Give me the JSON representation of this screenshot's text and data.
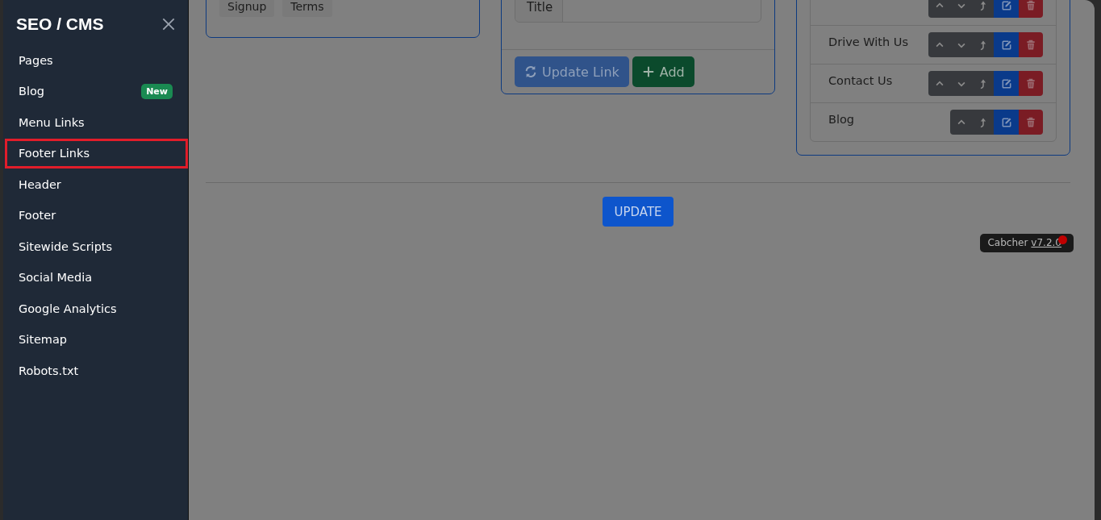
{
  "sidebar": {
    "title": "SEO / CMS",
    "items": [
      {
        "label": "Pages",
        "selected": false
      },
      {
        "label": "Blog",
        "selected": false,
        "badge": "New"
      },
      {
        "label": "Menu Links",
        "selected": false
      },
      {
        "label": "Footer Links",
        "selected": true
      },
      {
        "label": "Header",
        "selected": false
      },
      {
        "label": "Footer",
        "selected": false
      },
      {
        "label": "Sitewide Scripts",
        "selected": false
      },
      {
        "label": "Social Media",
        "selected": false
      },
      {
        "label": "Google Analytics",
        "selected": false
      },
      {
        "label": "Sitemap",
        "selected": false
      },
      {
        "label": "Robots.txt",
        "selected": false
      }
    ]
  },
  "link_tags": [
    "Signup",
    "Terms"
  ],
  "link_form": {
    "field_label": "Title",
    "buttons": [
      {
        "label": "Update Link",
        "kind": "update",
        "disabled": true
      },
      {
        "label": "Add",
        "kind": "add",
        "disabled": false
      }
    ]
  },
  "link_list": [
    {
      "actions": [
        {
          "kind": "up"
        },
        {
          "kind": "down"
        },
        {
          "kind": "top"
        },
        {
          "kind": "edit"
        },
        {
          "kind": "delete"
        }
      ]
    },
    {
      "label": "Drive With Us",
      "actions": [
        {
          "kind": "up"
        },
        {
          "kind": "down"
        },
        {
          "kind": "top"
        },
        {
          "kind": "edit"
        },
        {
          "kind": "delete"
        }
      ]
    },
    {
      "label": "Contact Us",
      "actions": [
        {
          "kind": "up"
        },
        {
          "kind": "down"
        },
        {
          "kind": "top"
        },
        {
          "kind": "edit"
        },
        {
          "kind": "delete"
        }
      ]
    },
    {
      "label": "Blog",
      "actions": [
        {
          "kind": "up"
        },
        {
          "kind": "top"
        },
        {
          "kind": "edit"
        },
        {
          "kind": "delete"
        }
      ]
    }
  ],
  "update_button": "UPDATE",
  "version_badge": {
    "name": "Cabcher",
    "version": "v7.2.0"
  }
}
